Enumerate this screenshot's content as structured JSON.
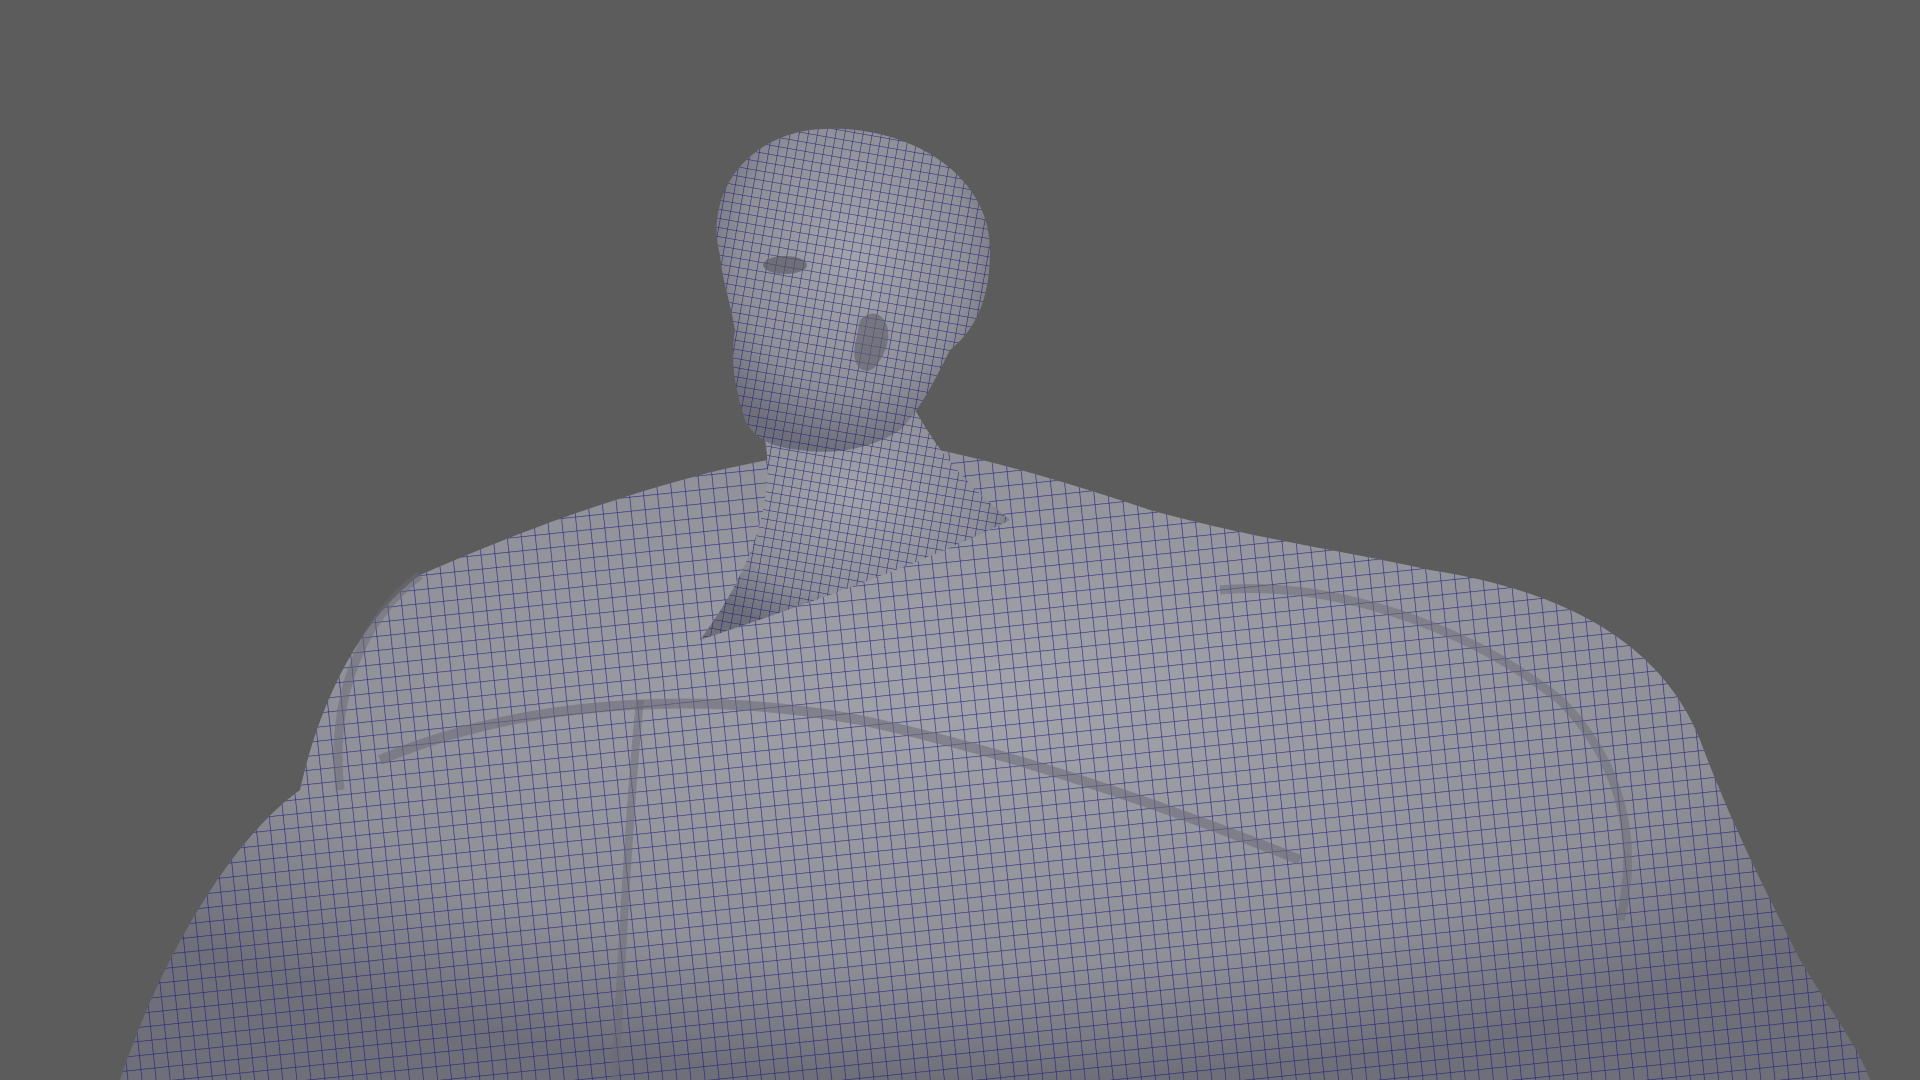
{
  "viewport": {
    "background_color": "#5c5c5c",
    "mesh_fill_color": "#8f8f98",
    "mesh_shadow_color": "#6f6f7a",
    "wireframe_color": "#1a1a7a",
    "display_mode": "wireframe-on-shaded",
    "object": "character-bust-mesh"
  }
}
